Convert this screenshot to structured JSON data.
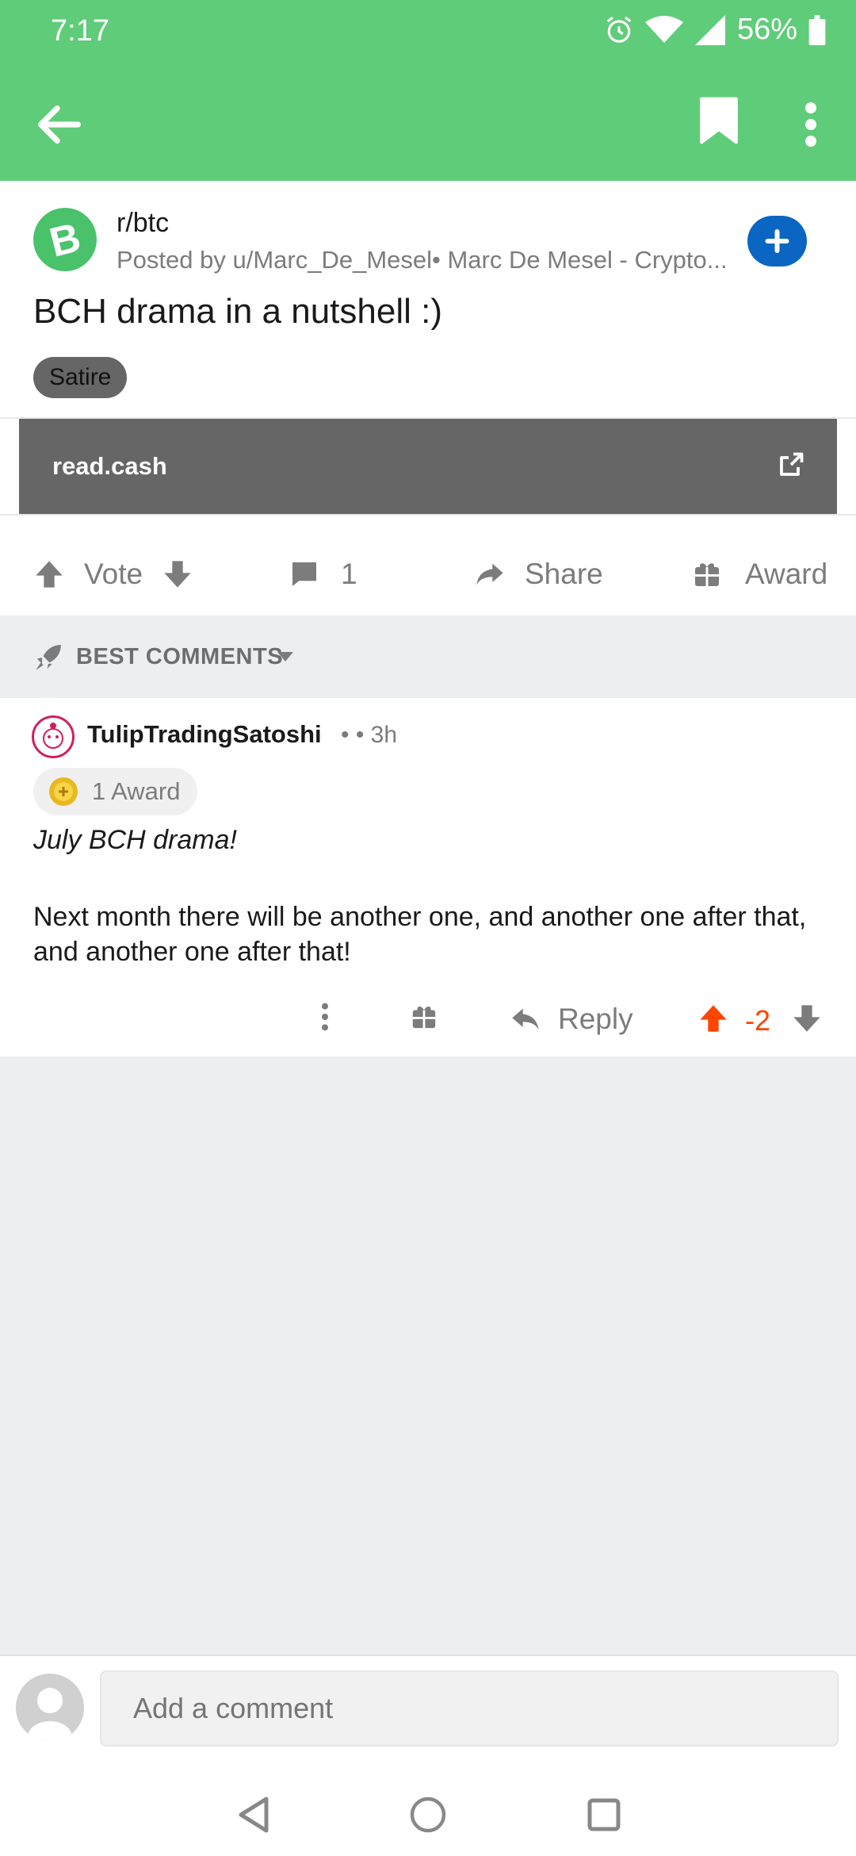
{
  "status": {
    "time": "7:17",
    "battery": "56%"
  },
  "post": {
    "subreddit": "r/btc",
    "posted_by": "Posted by u/Marc_De_Mesel• Marc De Mesel - Crypto...",
    "title": "BCH drama in a nutshell :)",
    "flair": "Satire",
    "link_domain": "read.cash"
  },
  "actions": {
    "vote": "Vote",
    "comments": "1",
    "share": "Share",
    "award": "Award"
  },
  "sort": {
    "label": "BEST COMMENTS"
  },
  "comment": {
    "user": "TulipTradingSatoshi",
    "time": "• • 3h",
    "award": "1 Award",
    "line1": "July BCH drama!",
    "line2": "Next month there will be another one, and another one after that, and another one after that!",
    "reply": "Reply",
    "score": "-2"
  },
  "composer": {
    "placeholder": "Add a comment"
  },
  "colors": {
    "accent": "#5fcc7a",
    "upvote": "#ff4500",
    "join": "#0a66c2"
  }
}
